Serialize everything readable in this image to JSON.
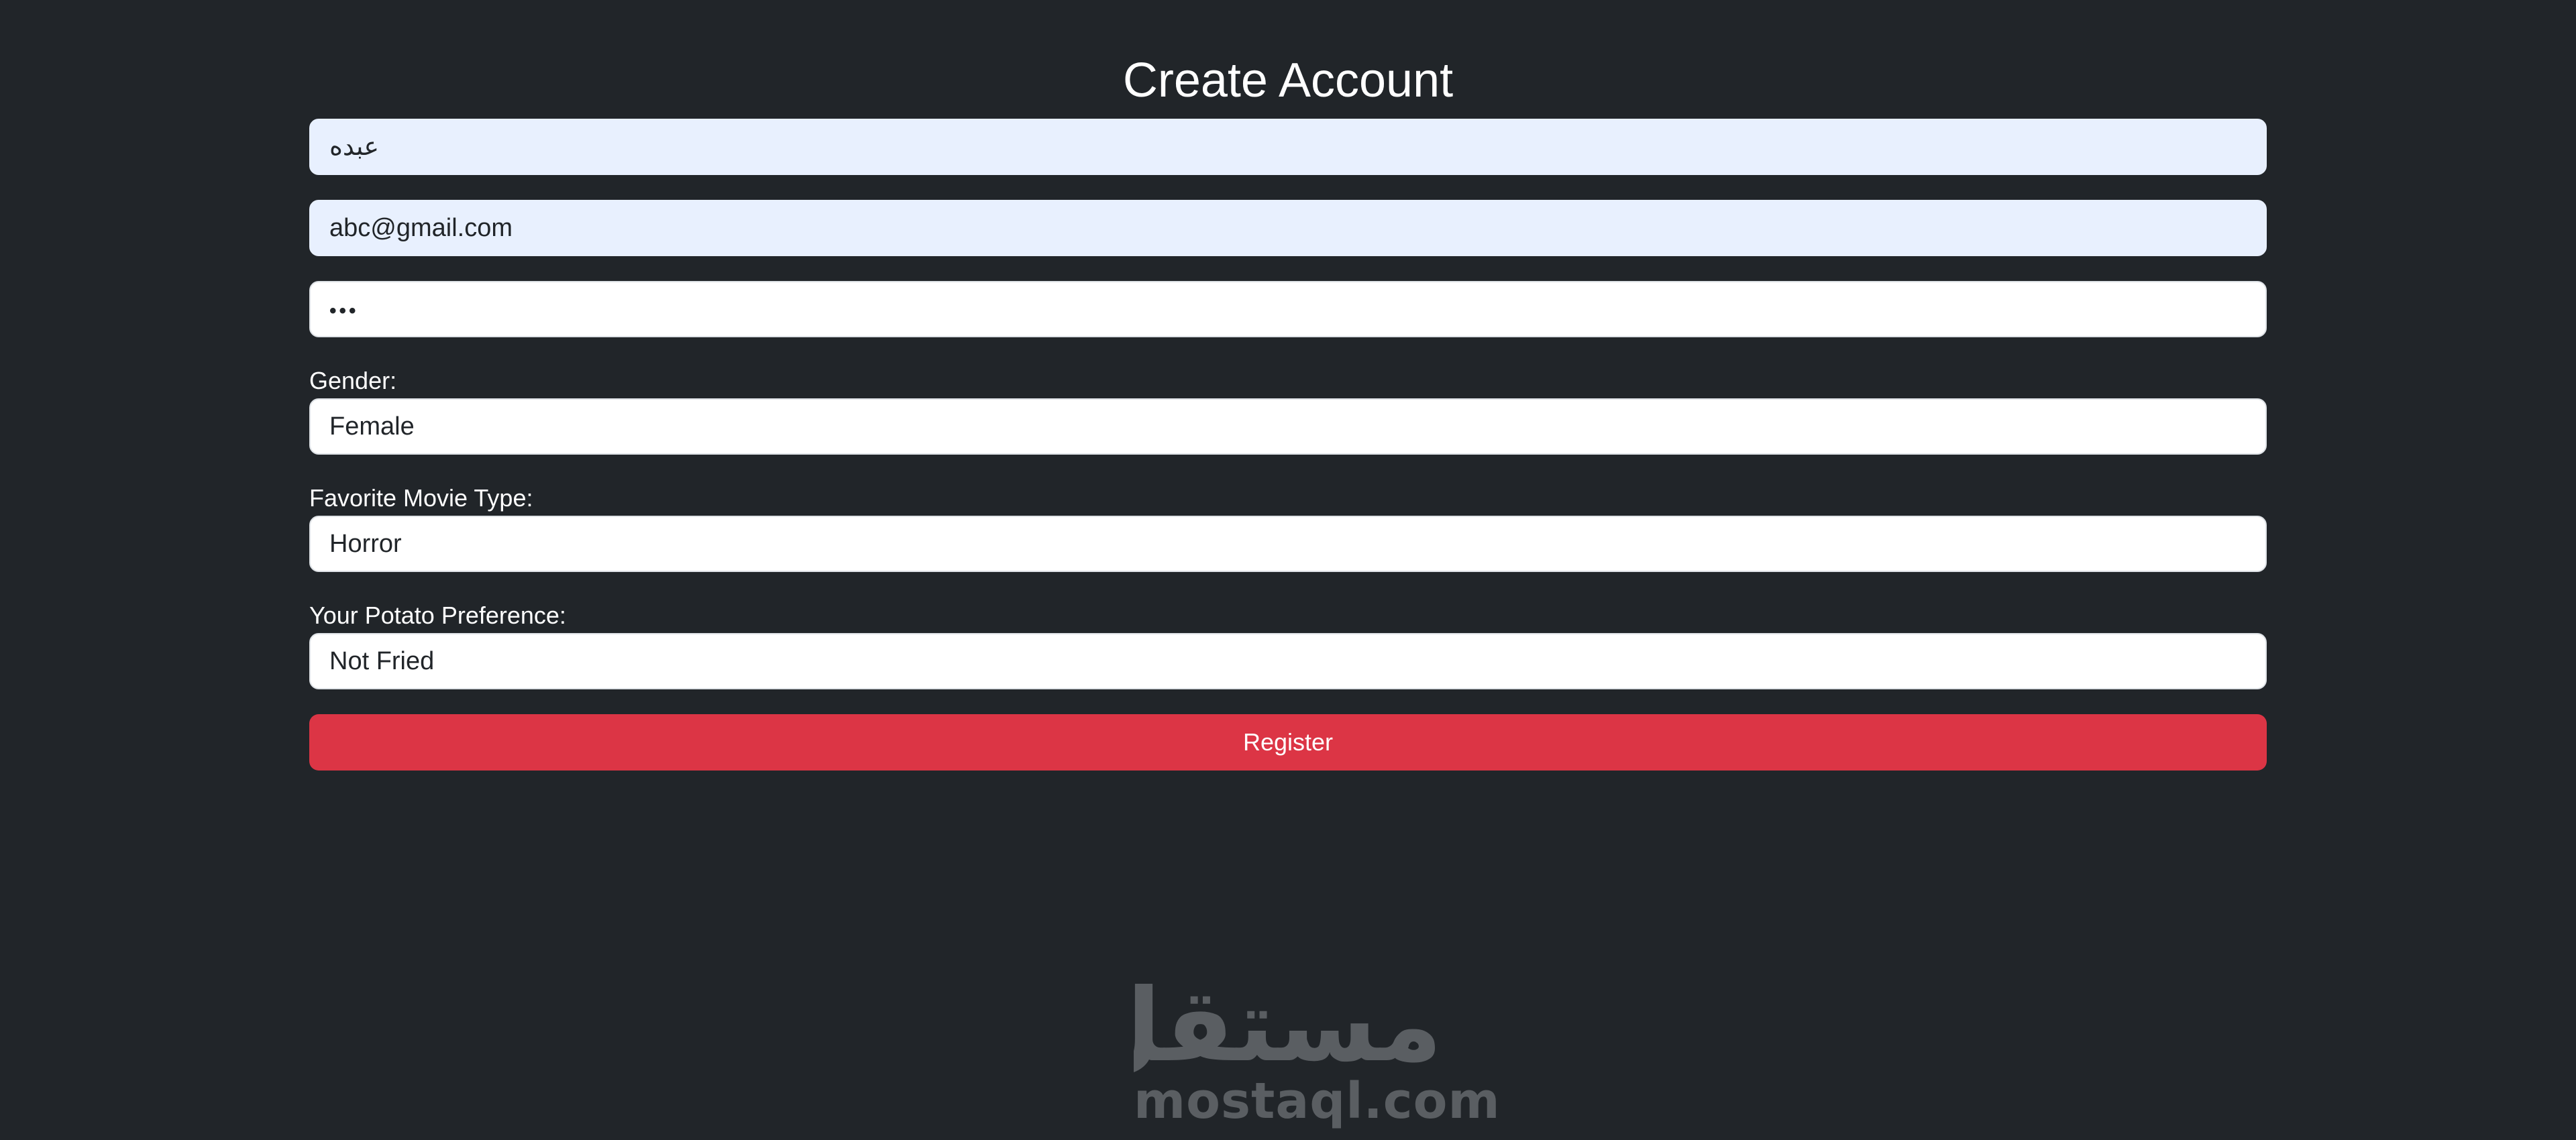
{
  "form": {
    "title": "Create Account",
    "name_value": "عبده",
    "email_value": "abc@gmail.com",
    "password_masked": "•••",
    "gender": {
      "label": "Gender:",
      "selected": "Female"
    },
    "movie_type": {
      "label": "Favorite Movie Type:",
      "selected": "Horror"
    },
    "potato": {
      "label": "Your Potato Preference:",
      "selected": "Not Fried"
    },
    "register_label": "Register"
  },
  "watermark": {
    "arabic": "مستقل",
    "latin": "mostaql.com"
  },
  "colors": {
    "background": "#212529",
    "autofill": "#e8f0fe",
    "button": "#dc3545",
    "watermark": "#5a5e62"
  }
}
